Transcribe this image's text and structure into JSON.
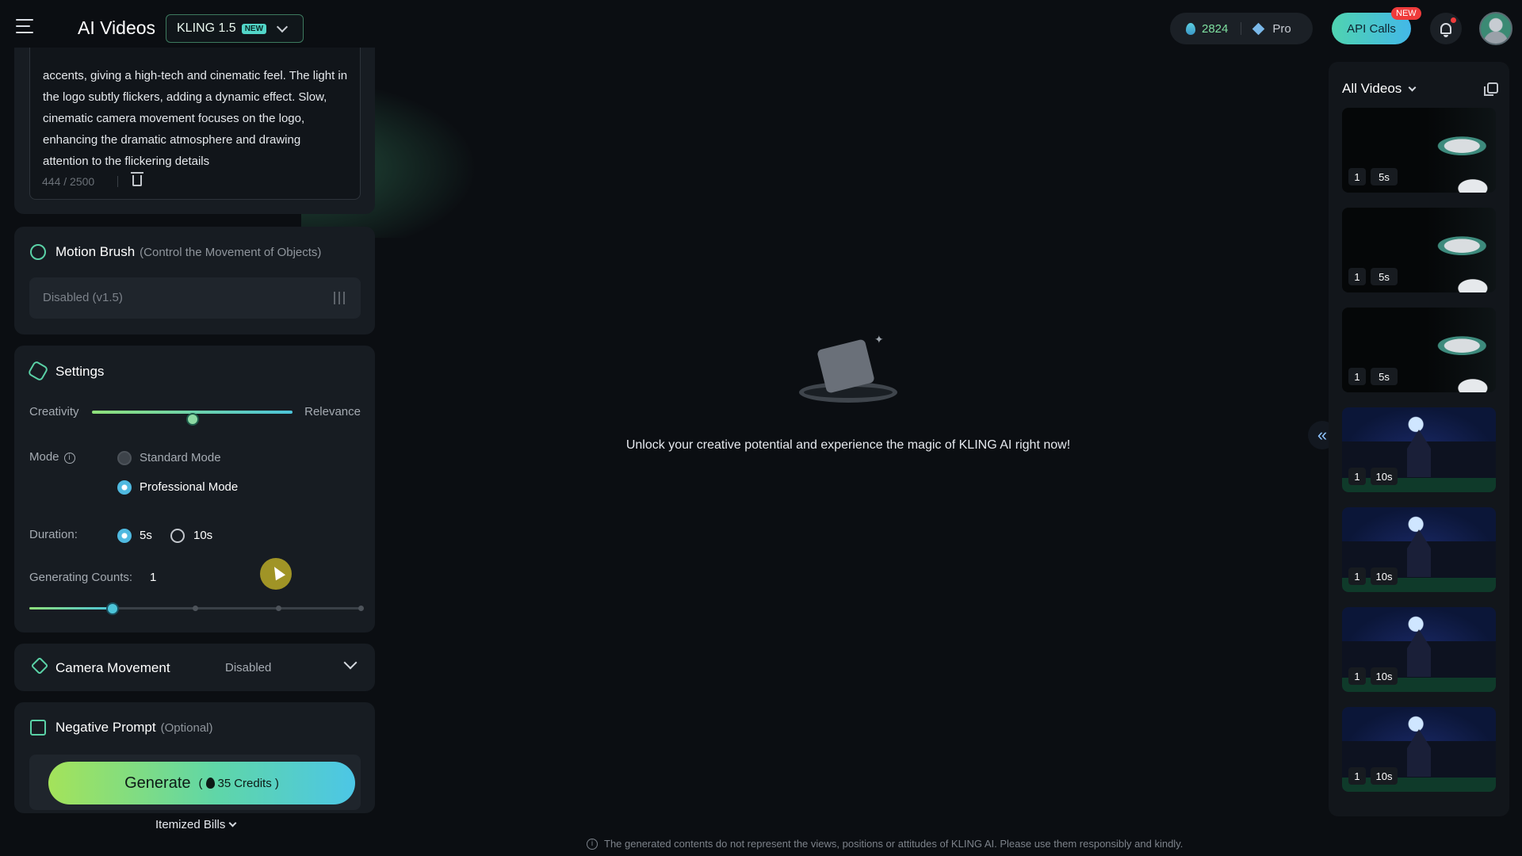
{
  "header": {
    "app_title": "AI Videos",
    "model_label": "KLING 1.5",
    "model_badge": "NEW",
    "credits": "2824",
    "plan": "Pro",
    "api_label": "API Calls",
    "api_badge": "NEW",
    "icons": [
      "menu-icon",
      "chevron-down-icon",
      "credit-drop-icon",
      "diamond-icon",
      "bell-icon",
      "avatar"
    ]
  },
  "prompt": {
    "text": "accents, giving a high-tech and cinematic feel. The light in the logo subtly flickers, adding a dynamic effect. Slow, cinematic camera movement focuses on the logo, enhancing the dramatic atmosphere and drawing attention to the flickering details",
    "counter": "444 / 2500"
  },
  "motion_brush": {
    "title": "Motion Brush",
    "subtitle": "(Control the Movement of Objects)",
    "value": "Disabled (v1.5)"
  },
  "settings": {
    "title": "Settings",
    "creativity_label": "Creativity",
    "relevance_label": "Relevance",
    "creativity_value": 0.5,
    "mode_label": "Mode",
    "modes": [
      "Standard Mode",
      "Professional Mode"
    ],
    "selected_mode": "Professional Mode",
    "duration_label": "Duration:",
    "durations": [
      "5s",
      "10s"
    ],
    "selected_duration": "5s",
    "counts_label": "Generating Counts:",
    "counts_value": "1",
    "counts_steps": 4,
    "counts_index": 1
  },
  "camera": {
    "title": "Camera Movement",
    "value": "Disabled"
  },
  "negative": {
    "title": "Negative Prompt",
    "subtitle": "(Optional)"
  },
  "generate": {
    "label": "Generate",
    "open": "(",
    "credits": "35",
    "credits_unit": "Credits )"
  },
  "itemized_label": "Itemized Bills",
  "main": {
    "empty_text": "Unlock your creative potential and experience the magic of KLING AI right now!",
    "disclaimer": "The generated contents do not represent the views, positions or attitudes of KLING AI. Please use them responsibly and kindly."
  },
  "videos": {
    "title": "All Videos",
    "items": [
      {
        "count": "1",
        "duration": "5s",
        "kind": "robot"
      },
      {
        "count": "1",
        "duration": "5s",
        "kind": "robot"
      },
      {
        "count": "1",
        "duration": "5s",
        "kind": "robot"
      },
      {
        "count": "1",
        "duration": "10s",
        "kind": "castle"
      },
      {
        "count": "1",
        "duration": "10s",
        "kind": "castle"
      },
      {
        "count": "1",
        "duration": "10s",
        "kind": "castle"
      },
      {
        "count": "1",
        "duration": "10s",
        "kind": "castle"
      }
    ]
  },
  "colors": {
    "accent_green": "#7ee0a0",
    "accent_cyan": "#4cc4d9",
    "background": "#0b0e12",
    "badge_red": "#ef3b3b"
  }
}
